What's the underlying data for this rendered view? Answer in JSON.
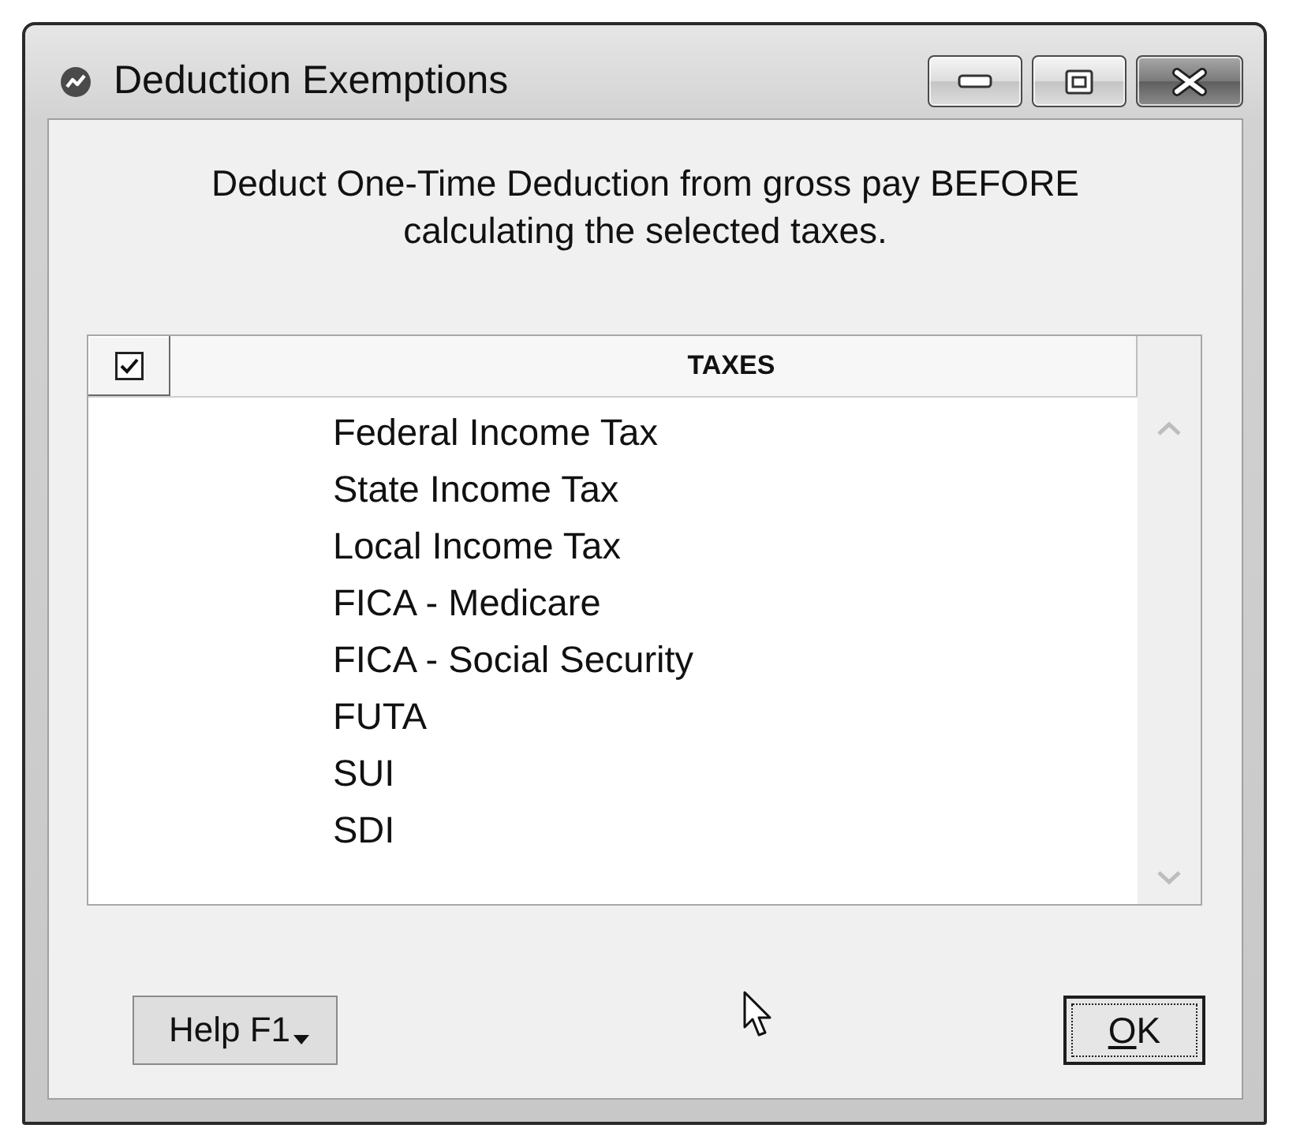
{
  "window": {
    "title": "Deduction Exemptions"
  },
  "instructions": "Deduct One-Time Deduction from gross pay BEFORE calculating the selected taxes.",
  "table": {
    "select_all": {
      "checked": true
    },
    "columns": [
      "TAXES"
    ],
    "rows": [
      "Federal Income Tax",
      "State Income Tax",
      "Local Income Tax",
      "FICA - Medicare",
      "FICA - Social Security",
      "FUTA",
      "SUI",
      "SDI"
    ]
  },
  "buttons": [
    {
      "label": "Help F1",
      "kind": "dropdown"
    },
    {
      "label": "OK",
      "kind": "default"
    }
  ]
}
